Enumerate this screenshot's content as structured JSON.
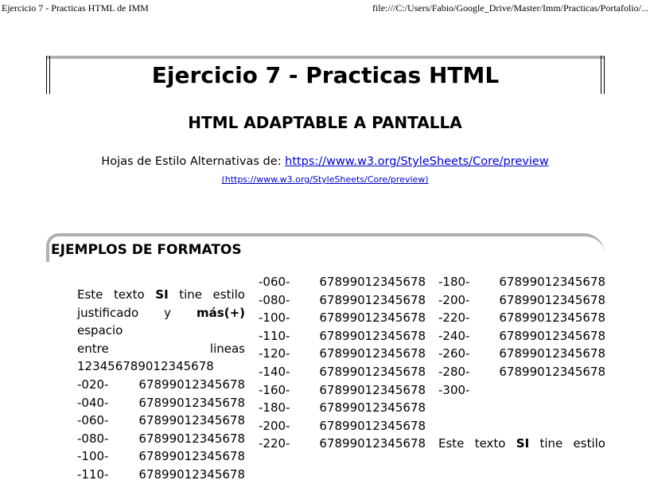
{
  "browser": {
    "page_title": "Ejercicio 7 - Practicas HTML de IMM",
    "url": "file:///C:/Users/Fabio/Google_Drive/Master/Imm/Practicas/Portafolio/..."
  },
  "document": {
    "title": "Ejercicio 7 - Practicas HTML",
    "subtitle": "HTML ADAPTABLE A PANTALLA",
    "alt_styles_label": "Hojas de Estilo Alternativas de:",
    "alt_styles_link": "https://www.w3.org/StyleSheets/Core/preview",
    "alt_styles_url_text": "(https://www.w3.org/StyleSheets/Core/preview)",
    "section_heading": "EJEMPLOS DE FORMATOS"
  },
  "col1": {
    "para_prefix": "Este texto",
    "para_si": "SI",
    "para_mid": "tine estilo",
    "line2_prefix": "justificado y",
    "line2_bold": "más(+)",
    "line2_suffix": "espacio",
    "line3_a": "entre",
    "line3_b": "lineas",
    "line4": "123456789012345678",
    "rows": [
      {
        "k": "-020-",
        "v": "67899012345678"
      },
      {
        "k": "-040-",
        "v": "67899012345678"
      },
      {
        "k": "-060-",
        "v": "67899012345678"
      },
      {
        "k": "-080-",
        "v": "67899012345678"
      },
      {
        "k": "-100-",
        "v": "67899012345678"
      },
      {
        "k": "-110-",
        "v": "67899012345678"
      }
    ]
  },
  "col2": {
    "rows": [
      {
        "k": "-060-",
        "v": "67899012345678"
      },
      {
        "k": "-080-",
        "v": "67899012345678"
      },
      {
        "k": "-100-",
        "v": "67899012345678"
      },
      {
        "k": "-110-",
        "v": "67899012345678"
      },
      {
        "k": "-120-",
        "v": "67899012345678"
      },
      {
        "k": "-140-",
        "v": "67899012345678"
      },
      {
        "k": "-160-",
        "v": "67899012345678"
      },
      {
        "k": "-180-",
        "v": "67899012345678"
      },
      {
        "k": "-200-",
        "v": "67899012345678"
      },
      {
        "k": "-220-",
        "v": "67899012345678"
      }
    ]
  },
  "col3": {
    "rows": [
      {
        "k": "-180-",
        "v": "67899012345678"
      },
      {
        "k": "-200-",
        "v": "67899012345678"
      },
      {
        "k": "-220-",
        "v": "67899012345678"
      },
      {
        "k": "-240-",
        "v": "67899012345678"
      },
      {
        "k": "-260-",
        "v": "67899012345678"
      },
      {
        "k": "-280-",
        "v": "67899012345678"
      },
      {
        "k": "-300-",
        "v": ""
      }
    ],
    "para_prefix": "Este texto",
    "para_si": "SI",
    "para_mid": "tine estilo"
  }
}
